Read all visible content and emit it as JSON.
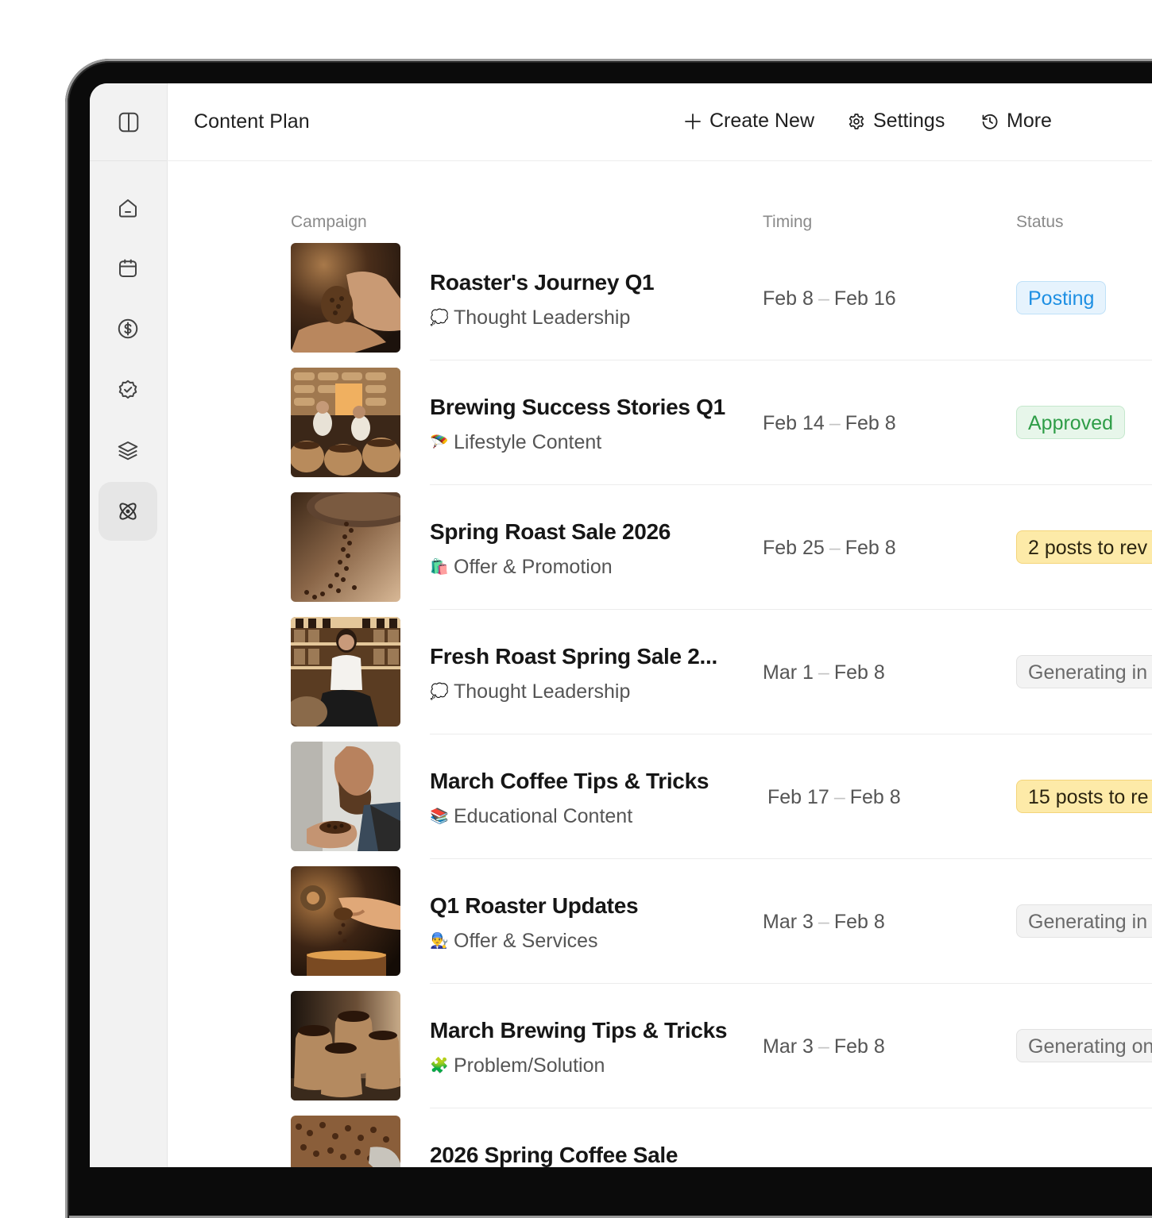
{
  "header": {
    "title": "Content Plan",
    "actions": [
      {
        "label": "Create New",
        "icon": "plus-icon"
      },
      {
        "label": "Settings",
        "icon": "gear-icon"
      },
      {
        "label": "More",
        "icon": "history-icon"
      }
    ]
  },
  "sidebar": {
    "items": [
      {
        "icon": "home-icon"
      },
      {
        "icon": "calendar-icon"
      },
      {
        "icon": "dollar-icon"
      },
      {
        "icon": "badge-check-icon"
      },
      {
        "icon": "layers-icon"
      },
      {
        "icon": "atom-icon",
        "active": true
      }
    ]
  },
  "table": {
    "columns": {
      "campaign": "Campaign",
      "timing": "Timing",
      "status": "Status"
    },
    "rows": [
      {
        "title": "Roaster's Journey Q1",
        "emoji": "💭",
        "category": "Thought Leadership",
        "start": "Feb 8",
        "end": "Feb 16",
        "status": "Posting",
        "status_color": "blue"
      },
      {
        "title": "Brewing Success Stories Q1",
        "emoji": "🪂",
        "category": "Lifestyle Content",
        "start": "Feb 14",
        "end": "Feb 8",
        "status": "Approved",
        "status_color": "green"
      },
      {
        "title": "Spring Roast Sale 2026",
        "emoji": "🛍️",
        "category": "Offer & Promotion",
        "start": "Feb 25",
        "end": "Feb 8",
        "status": "2 posts to rev",
        "status_color": "yellow"
      },
      {
        "title": "Fresh Roast Spring Sale 2...",
        "emoji": "💭",
        "category": "Thought Leadership",
        "start": "Mar 1",
        "end": "Feb 8",
        "status": "Generating in",
        "status_color": "gray"
      },
      {
        "title": "March Coffee Tips & Tricks",
        "emoji": "📚",
        "category": "Educational Content",
        "start": "Feb 17",
        "end": "Feb 8",
        "status": "15 posts to re",
        "status_color": "yellow"
      },
      {
        "title": "Q1 Roaster Updates",
        "emoji": "👨‍🔧",
        "category": "Offer & Services",
        "start": "Mar 3",
        "end": "Feb 8",
        "status": "Generating in",
        "status_color": "gray"
      },
      {
        "title": "March Brewing Tips & Tricks",
        "emoji": "🧩",
        "category": "Problem/Solution",
        "start": "Mar 3",
        "end": "Feb 8",
        "status": "Generating on",
        "status_color": "gray"
      },
      {
        "title": "2026 Spring Coffee Sale",
        "emoji": "",
        "category": "",
        "start": "",
        "end": "",
        "status": "",
        "status_color": "gray"
      }
    ]
  },
  "colors": {
    "accent_blue": "#1d8fe3",
    "approved_green": "#2e9d47",
    "review_yellow": "#fdeaa8",
    "rail_bg": "#f2f2f2"
  }
}
